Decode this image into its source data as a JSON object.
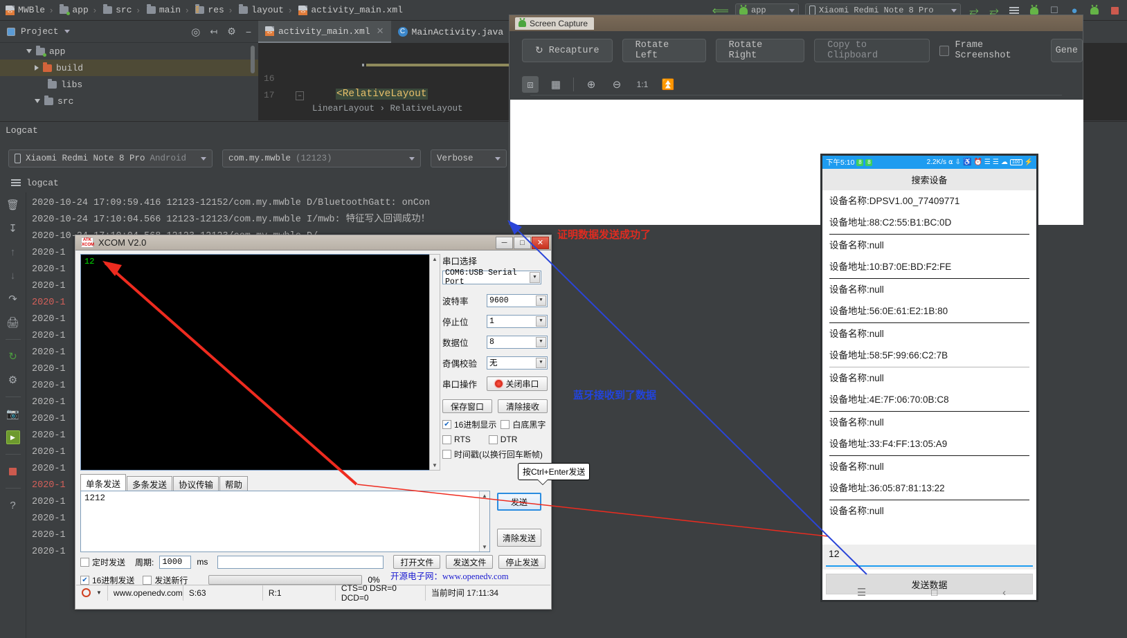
{
  "ide": {
    "breadcrumb": [
      {
        "label": "MWBle",
        "icon": "module-icon"
      },
      {
        "label": "app",
        "icon": "folder-module-icon"
      },
      {
        "label": "src",
        "icon": "folder-icon"
      },
      {
        "label": "main",
        "icon": "folder-icon"
      },
      {
        "label": "res",
        "icon": "res-folder-icon"
      },
      {
        "label": "layout",
        "icon": "folder-icon"
      },
      {
        "label": "activity_main.xml",
        "icon": "xml-file-icon"
      }
    ],
    "toolbar_right": {
      "run_config": "app",
      "device": "Xiaomi Redmi Note 8 Pro",
      "icons": [
        "back-arrow-icon",
        "android-icon",
        "phone-icon",
        "redo-icon",
        "redo2-icon",
        "menu-icon",
        "avd-icon",
        "layout-icon",
        "profiler-icon",
        "sdk-icon",
        "stop-icon"
      ]
    },
    "project_panel": {
      "title": "Project",
      "tree": [
        {
          "label": "app",
          "depth": 1,
          "expanded": true,
          "icon": "folder-module-icon",
          "selected": false
        },
        {
          "label": "build",
          "depth": 2,
          "expanded": false,
          "icon": "folder-orange-icon",
          "selected": true
        },
        {
          "label": "libs",
          "depth": 2,
          "expanded": null,
          "icon": "folder-icon",
          "selected": false
        },
        {
          "label": "src",
          "depth": 1,
          "expanded": true,
          "icon": "folder-icon",
          "selected": false
        }
      ]
    },
    "editor": {
      "tabs": [
        {
          "label": "activity_main.xml",
          "icon": "xml-file-icon",
          "active": true,
          "closable": true
        },
        {
          "label": "MainActivity.java",
          "icon": "java-file-icon",
          "active": false,
          "closable": false
        }
      ],
      "gutter_lines": [
        "16",
        "17"
      ],
      "code": "<RelativeLayout",
      "code_breadcrumb": "LinearLayout  ›  RelativeLayout"
    },
    "logcat": {
      "title": "Logcat",
      "device_selector": "Xiaomi Redmi Note 8 Pro",
      "device_selector_dim": "Android",
      "process_selector": "com.my.mwble",
      "process_pid": "(12123)",
      "level_selector": "Verbose",
      "tool_label": "logcat",
      "sidebar_icons": [
        "trash-icon",
        "scroll-to-end-icon",
        "up-arrow-icon",
        "down-arrow-icon",
        "soft-wrap-icon",
        "print-icon",
        "restart-icon",
        "settings-icon",
        "screenshot-icon",
        "run-icon",
        "stop-icon",
        "help-icon"
      ],
      "lines": [
        {
          "text": "2020-10-24 17:09:59.416 12123-12152/com.my.mwble D/BluetoothGatt: onCon",
          "error": false
        },
        {
          "text": "2020-10-24 17:10:04.566 12123-12123/com.my.mwble I/mwb: 特征写入回调成功！",
          "error": false
        },
        {
          "text": "2020-10-24 17:10:04.568 12123-12123/com.my.mwble D/...",
          "error": false
        },
        {
          "text": "2020-1",
          "error": false
        },
        {
          "text": "2020-1",
          "error": false
        },
        {
          "text": "2020-1",
          "error": false
        },
        {
          "text": "2020-1",
          "error": true
        },
        {
          "text": "2020-1",
          "error": false
        },
        {
          "text": "2020-1",
          "error": false
        },
        {
          "text": "2020-1",
          "error": false
        },
        {
          "text": "2020-1",
          "error": false
        },
        {
          "text": "2020-1",
          "error": false
        },
        {
          "text": "2020-1",
          "error": false
        },
        {
          "text": "2020-1",
          "error": false
        },
        {
          "text": "2020-1",
          "error": false
        },
        {
          "text": "2020-1",
          "error": false
        },
        {
          "text": "2020-1",
          "error": false
        },
        {
          "text": "2020-1",
          "error": true
        },
        {
          "text": "2020-1",
          "error": false
        },
        {
          "text": "2020-1",
          "error": false
        },
        {
          "text": "2020-1",
          "error": false
        },
        {
          "text": "2020-1",
          "error": false
        }
      ]
    }
  },
  "screen_capture": {
    "window_title": "Screen Capture",
    "buttons": [
      {
        "label": "Recapture",
        "icon": "refresh-icon",
        "dim": false
      },
      {
        "label": "Rotate Left",
        "icon": null,
        "dim": false
      },
      {
        "label": "Rotate Right",
        "icon": null,
        "dim": false
      },
      {
        "label": "Copy to Clipboard",
        "icon": null,
        "dim": true
      }
    ],
    "frame_checkbox_label": "Frame Screenshot",
    "frame_checkbox_checked": false,
    "generate_label": "Gene",
    "zoom_tools": [
      "fit-icon",
      "grid-icon",
      "zoom-in-icon",
      "zoom-out-icon",
      "actual-size-icon",
      "fit-window-icon"
    ]
  },
  "phone": {
    "status_bar": {
      "time": "下午5:10",
      "badges": [
        "8",
        "8"
      ],
      "net_speed": "2.2K/s",
      "icons": [
        "headphones-icon",
        "bluetooth-icon",
        "mute-icon",
        "alarm-icon",
        "signal1-icon",
        "signal2-icon",
        "wifi-icon"
      ],
      "battery": "100"
    },
    "app_bar_title": "搜索设备",
    "devices": [
      {
        "name": "设备名称:DPSV1.00_77409771",
        "addr": "设备地址:88:C2:55:B1:BC:0D"
      },
      {
        "name": "设备名称:null",
        "addr": "设备地址:10:B7:0E:BD:F2:FE"
      },
      {
        "name": "设备名称:null",
        "addr": "设备地址:56:0E:61:E2:1B:80"
      },
      {
        "name": "设备名称:null",
        "addr": "设备地址:58:5F:99:66:C2:7B"
      },
      {
        "name": "设备名称:null",
        "addr": "设备地址:4E:7F:06:70:0B:C8"
      },
      {
        "name": "设备名称:null",
        "addr": "设备地址:33:F4:FF:13:05:A9"
      },
      {
        "name": "设备名称:null",
        "addr": "设备地址:36:05:87:81:13:22"
      },
      {
        "name": "设备名称:null",
        "addr": ""
      }
    ],
    "input_value": "12",
    "send_button_label": "发送数据",
    "nav_icons": [
      "recents-icon",
      "home-icon",
      "back-icon"
    ]
  },
  "xcom": {
    "title": "XCOM V2.0",
    "logo_text": "ATK XCOM",
    "window_buttons": [
      "minimize-icon",
      "maximize-icon",
      "close-icon"
    ],
    "receive_text": "12",
    "serial": {
      "section_label": "串口选择",
      "port_value": "COM6:USB Serial Port",
      "rows": [
        {
          "label": "波特率",
          "value": "9600"
        },
        {
          "label": "停止位",
          "value": "1"
        },
        {
          "label": "数据位",
          "value": "8"
        },
        {
          "label": "奇偶校验",
          "value": "无"
        }
      ],
      "operation_label": "串口操作",
      "operation_button": "关闭串口"
    },
    "buttons": {
      "save_window": "保存窗口",
      "clear_receive": "清除接收",
      "clear_send": "清除发送",
      "open_file": "打开文件",
      "send_file": "发送文件",
      "stop_send": "停止发送",
      "send": "发送"
    },
    "checks": {
      "hex_display": {
        "label": "16进制显示",
        "checked": true
      },
      "white_bg": {
        "label": "白底黑字",
        "checked": false
      },
      "rts": {
        "label": "RTS",
        "checked": false
      },
      "dtr": {
        "label": "DTR",
        "checked": false
      },
      "timestamp": {
        "label": "时间戳(以换行回车断帧)",
        "checked": false
      },
      "timed_send": {
        "label": "定时发送",
        "checked": false
      },
      "hex_send": {
        "label": "16进制发送",
        "checked": true
      },
      "send_newline": {
        "label": "发送新行",
        "checked": false
      }
    },
    "tabs": [
      {
        "label": "单条发送",
        "active": true
      },
      {
        "label": "多条发送",
        "active": false
      },
      {
        "label": "协议传输",
        "active": false
      },
      {
        "label": "帮助",
        "active": false
      }
    ],
    "send_text": "1212",
    "tooltip": "按Ctrl+Enter发送",
    "period_label": "周期:",
    "period_value": "1000",
    "period_unit": "ms",
    "file_path": "",
    "progress_percent": "0%",
    "website_text": "开源电子网：www.openedv.com",
    "status_bar": {
      "site": "www.openedv.com",
      "sent": "S:63",
      "received": "R:1",
      "flow": "CTS=0 DSR=0 DCD=0",
      "time_label": "当前时间 17:11:34"
    }
  },
  "annotations": {
    "red_note": "证明数据发送成功了",
    "blue_note": "蓝牙接收到了数据",
    "red_color": "#e02b20",
    "blue_color": "#2244dd"
  }
}
